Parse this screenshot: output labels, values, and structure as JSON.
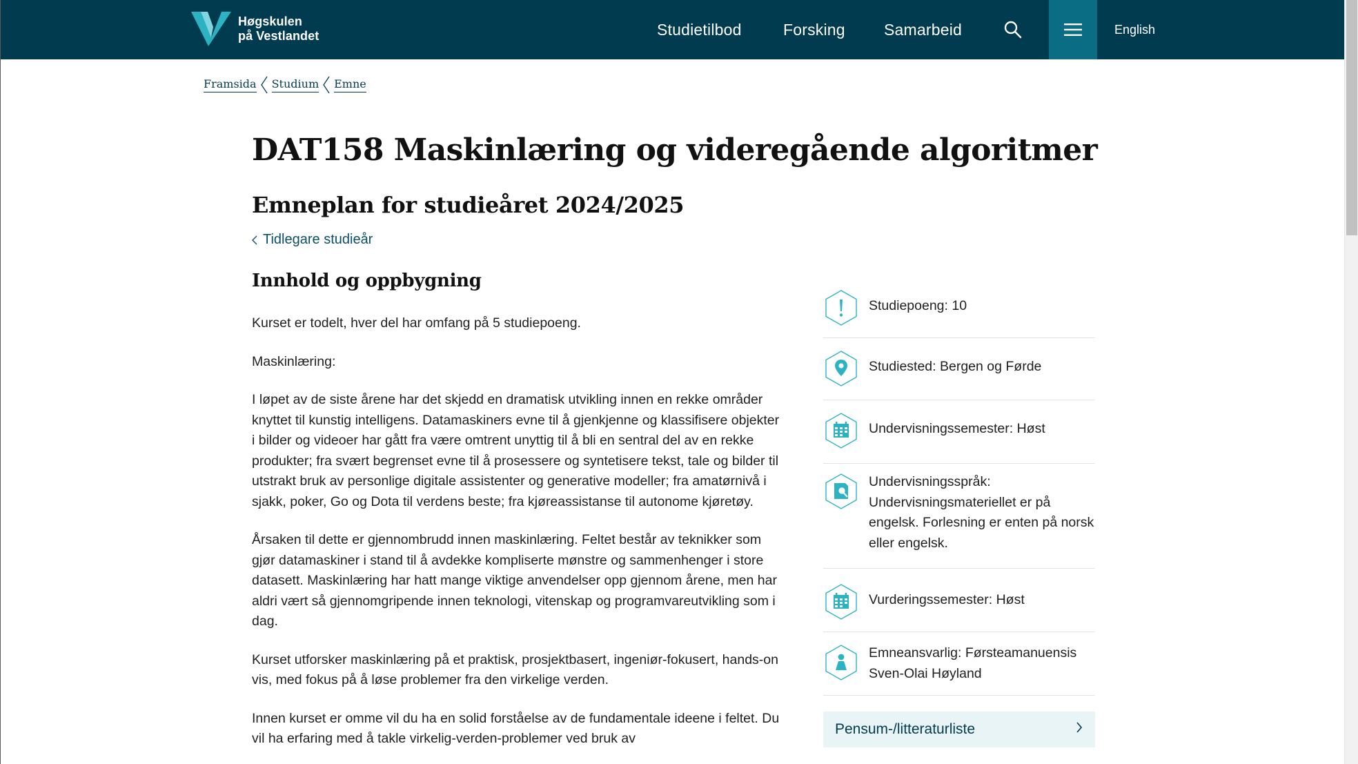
{
  "header": {
    "logo_line1": "Høgskulen",
    "logo_line2": "på Vestlandet",
    "nav": [
      "Studietilbod",
      "Forsking",
      "Samarbeid"
    ],
    "language_label": "English",
    "icons": {
      "search": "search-icon",
      "menu": "hamburger-menu-icon"
    }
  },
  "breadcrumb": [
    "Framsida",
    "Studium",
    "Emne"
  ],
  "page": {
    "title": "DAT158 Maskinlæring og videregående algoritmer",
    "subtitle": "Emneplan for studieåret 2024/2025",
    "previous_years_link": "Tidlegare studieår"
  },
  "content": {
    "heading": "Innhold og oppbygning",
    "paragraphs": [
      "Kurset er todelt, hver del har omfang på 5 studiepoeng.",
      "Maskinlæring:",
      "I løpet av de siste årene har det skjedd en dramatisk utvikling innen en rekke områder knyttet til kunstig intelligens. Datamaskiners evne til å gjenkjenne og klassifisere objekter i bilder og videoer har gått fra være omtrent unyttig til å bli en sentral del av en rekke produkter; fra svært begrenset evne til å prosessere og syntetisere tekst, tale og bilder til utstrakt bruk av personlige digitale assistenter og generative modeller; fra amatørnivå i sjakk, poker, Go og Dota til verdens beste; fra kjøreassistanse til autonome kjøretøy.",
      "Årsaken til dette er gjennombrudd innen maskinlæring. Feltet består av teknikker som gjør datamaskiner i stand til å avdekke kompliserte mønstre og sammenhenger i store datasett. Maskinlæring har hatt mange viktige anvendelser opp gjennom årene, men har aldri vært så gjennomgripende innen teknologi, vitenskap og programvareutvikling som i dag.",
      "Kurset utforsker maskinlæring på et praktisk, prosjektbasert, ingeniør-fokusert, hands-on vis, med fokus på å løse problemer fra den virkelige verden.",
      "Innen kurset er omme vil du ha en solid forståelse av de fundamentale ideene i feltet. Du vil ha erfaring med å takle virkelig-verden-problemer ved bruk av"
    ]
  },
  "facts": [
    {
      "icon": "exclamation-hex-icon",
      "text": "Studiepoeng: 10"
    },
    {
      "icon": "location-pin-hex-icon",
      "text": "Studiested: Bergen og Førde"
    },
    {
      "icon": "calendar-hex-icon",
      "text": "Undervisningssemester: Høst"
    },
    {
      "icon": "language-hex-icon",
      "text": "Undervisningsspråk: Undervisningsmateriellet er på engelsk. Forlesning er enten på norsk eller engelsk."
    },
    {
      "icon": "calendar-hex-icon",
      "text": "Vurderingssemester: Høst"
    },
    {
      "icon": "person-hex-icon",
      "text": "Emneansvarlig: Førsteamanuensis Sven-Olai Høyland"
    }
  ],
  "pensum": {
    "label": "Pensum-/litteraturliste",
    "icon": "chevron-right-icon"
  },
  "colors": {
    "header_bg": "#003b4f",
    "menu_button_bg": "#0a6d83",
    "accent_teal": "#2bb3c4",
    "pensum_bg": "#e9f4f6",
    "link": "#0a4f66"
  }
}
